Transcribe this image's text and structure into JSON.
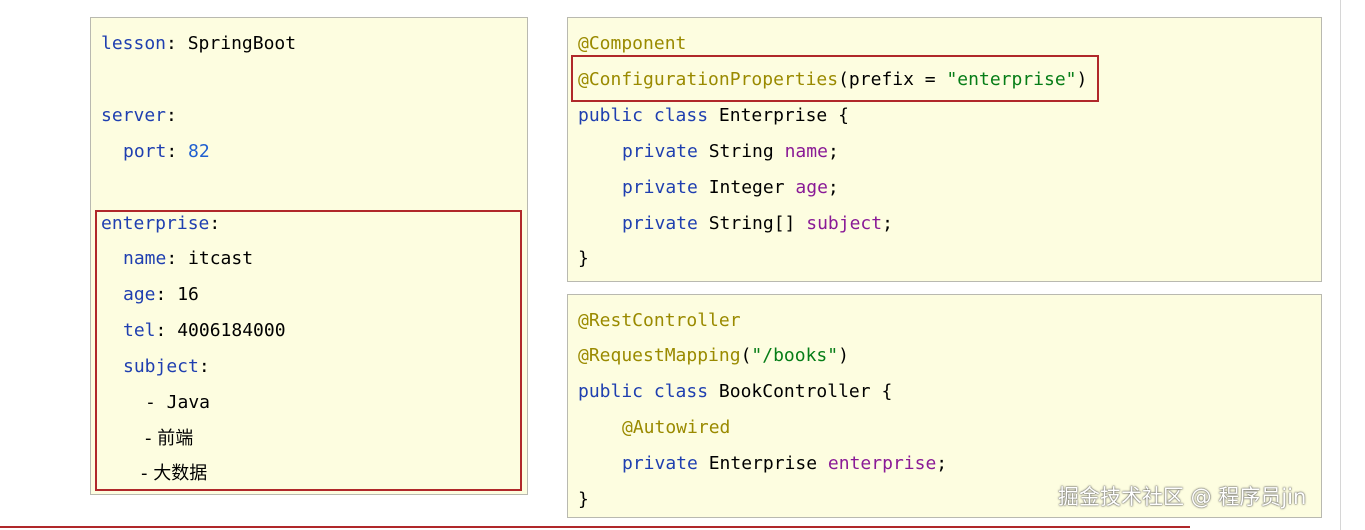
{
  "yaml": {
    "lesson_key": "lesson",
    "lesson_value": "SpringBoot",
    "server_key": "server",
    "port_key": "port",
    "port_value": "82",
    "enterprise_key": "enterprise",
    "name_key": "name",
    "name_value": "itcast",
    "age_key": "age",
    "age_value": "16",
    "tel_key": "tel",
    "tel_value": "4006184000",
    "subject_key": "subject",
    "subjects": [
      "- Java",
      "- 前端",
      "- 大数据"
    ]
  },
  "enterprise_class": {
    "annotation_component": "@Component",
    "annotation_config": "@ConfigurationProperties",
    "prefix_open": "(prefix = ",
    "prefix_value": "\"enterprise\"",
    "prefix_close": ")",
    "decl_keywords": "public class",
    "class_name": "Enterprise {",
    "modifier": "private",
    "fields": [
      {
        "type": "String",
        "name": "name"
      },
      {
        "type": "Integer",
        "name": "age"
      },
      {
        "type": "String[]",
        "name": "subject"
      }
    ],
    "close": "}"
  },
  "controller_class": {
    "annotation_rest": "@RestController",
    "annotation_mapping": "@RequestMapping",
    "mapping_open": "(",
    "mapping_value": "\"/books\"",
    "mapping_close": ")",
    "decl_keywords": "public class",
    "class_name": "BookController {",
    "annotation_autowired": "@Autowired",
    "modifier": "private",
    "field_type": "Enterprise",
    "field_name": "enterprise",
    "close": "}"
  },
  "watermark": "掘金技术社区 @ 程序员jin",
  "colors": {
    "panel_background": "#fdfde0",
    "highlight_border": "#b0282a",
    "keyword": "#1f3fb0",
    "annotation": "#9a8a00",
    "string": "#067d17",
    "field": "#8a1a96"
  }
}
